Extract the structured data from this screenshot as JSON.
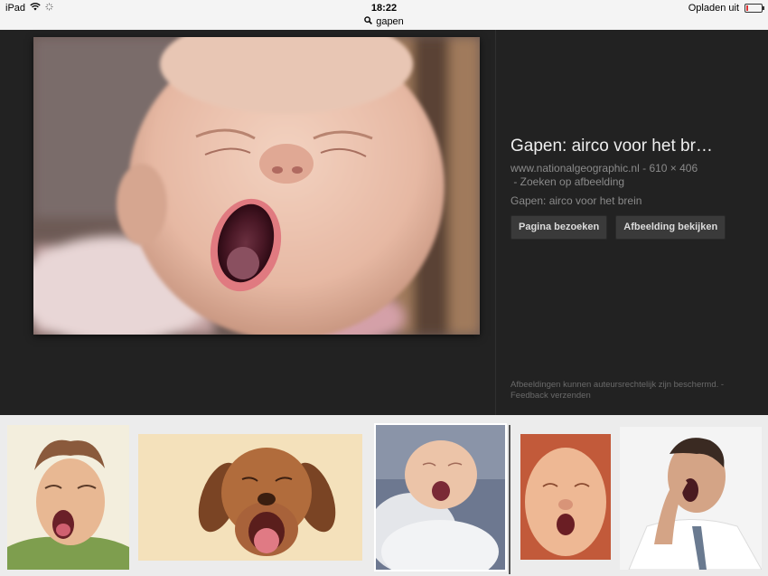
{
  "status_bar": {
    "device": "iPad",
    "time": "18:22",
    "charging_label": "Opladen uit",
    "battery_level": 0.1
  },
  "search": {
    "query": "gapen"
  },
  "viewer": {
    "title": "Gapen: airco voor het br…",
    "source_domain": "www.nationalgeographic.nl",
    "dimensions": "- 610 × 406",
    "search_by_image": "- Zoeken op afbeelding",
    "caption": "Gapen: airco voor het brein",
    "visit_page_button": "Pagina bezoeken",
    "view_image_button": "Afbeelding bekijken",
    "legal_text": "Afbeeldingen kunnen auteursrechtelijk zijn beschermd. -",
    "feedback_link": "Feedback verzenden"
  },
  "colors": {
    "viewer_bg": "#222222",
    "strip_bg": "#ececec",
    "status_bg": "#f4f4f4"
  }
}
